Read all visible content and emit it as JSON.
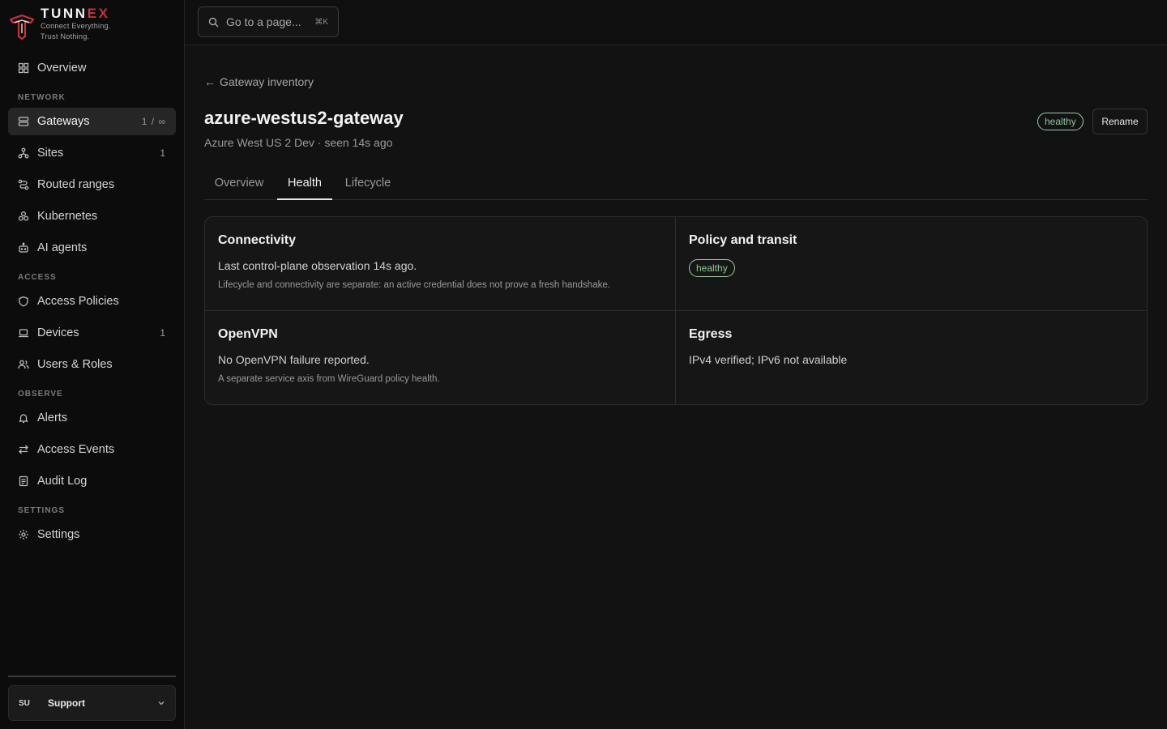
{
  "brand": {
    "name_main": "TUNN",
    "name_accent": "EX",
    "tagline_1": "Connect Everything.",
    "tagline_2": "Trust Nothing.",
    "accent_color": "#c8323a"
  },
  "sidebar": {
    "overview": {
      "label": "Overview",
      "icon": "grid-icon"
    },
    "sections": {
      "network": "NETWORK",
      "access": "ACCESS",
      "observe": "OBSERVE",
      "settings": "SETTINGS"
    },
    "items": {
      "gateways": {
        "label": "Gateways",
        "count": "1 / ∞",
        "icon": "server-icon",
        "active": true
      },
      "sites": {
        "label": "Sites",
        "count": "1",
        "icon": "network-icon"
      },
      "routed_ranges": {
        "label": "Routed ranges",
        "icon": "route-icon"
      },
      "kubernetes": {
        "label": "Kubernetes",
        "icon": "kubernetes-icon"
      },
      "ai_agents": {
        "label": "AI agents",
        "icon": "bot-icon"
      },
      "access_policies": {
        "label": "Access Policies",
        "icon": "shield-icon"
      },
      "devices": {
        "label": "Devices",
        "count": "1",
        "icon": "laptop-icon"
      },
      "users_roles": {
        "label": "Users & Roles",
        "icon": "users-icon"
      },
      "alerts": {
        "label": "Alerts",
        "icon": "bell-icon"
      },
      "access_events": {
        "label": "Access Events",
        "icon": "arrows-icon"
      },
      "audit_log": {
        "label": "Audit Log",
        "icon": "document-icon"
      },
      "settings": {
        "label": "Settings",
        "icon": "gear-icon"
      }
    },
    "user": {
      "initials": "SU",
      "name": "Support"
    }
  },
  "topbar": {
    "search_placeholder": "Go to a page...",
    "shortcut": "⌘K"
  },
  "page": {
    "back_label": "Gateway inventory",
    "title": "azure-westus2-gateway",
    "subtitle": "Azure West US 2 Dev · seen 14s ago",
    "status": "healthy",
    "status_color": "#8dc79a",
    "rename_label": "Rename",
    "tabs": [
      "Overview",
      "Health",
      "Lifecycle"
    ],
    "active_tab": "Health"
  },
  "health": {
    "connectivity": {
      "title": "Connectivity",
      "body": "Last control-plane observation 14s ago.",
      "note": "Lifecycle and connectivity are separate: an active credential does not prove a fresh handshake."
    },
    "policy": {
      "title": "Policy and transit",
      "status": "healthy"
    },
    "openvpn": {
      "title": "OpenVPN",
      "body": "No OpenVPN failure reported.",
      "note": "A separate service axis from WireGuard policy health."
    },
    "egress": {
      "title": "Egress",
      "body": "IPv4 verified; IPv6 not available"
    }
  }
}
